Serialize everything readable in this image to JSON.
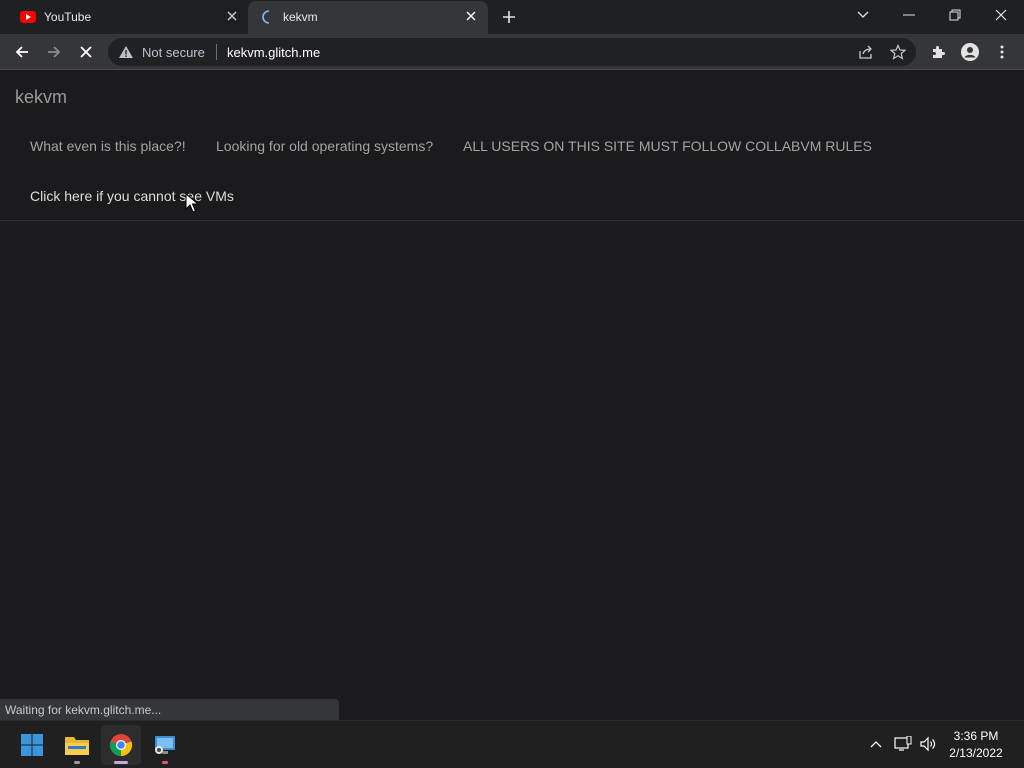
{
  "browser": {
    "tabs": [
      {
        "title": "YouTube",
        "favicon": "youtube-icon",
        "active": false
      },
      {
        "title": "kekvm",
        "favicon": "loading-spinner-icon",
        "active": true
      }
    ],
    "omnibox": {
      "security_label": "Not secure",
      "url": "kekvm.glitch.me"
    },
    "status_text": "Waiting for kekvm.glitch.me..."
  },
  "page": {
    "brand": "kekvm",
    "nav": [
      "What even is this place?!",
      "Looking for old operating systems?",
      "ALL USERS ON THIS SITE MUST FOLLOW COLLABVM RULES"
    ],
    "cta": "Click here if you cannot see VMs"
  },
  "taskbar": {
    "apps": [
      "start-icon",
      "file-explorer-icon",
      "chrome-icon",
      "remote-desktop-icon"
    ],
    "clock_time": "3:36 PM",
    "clock_date": "2/13/2022"
  },
  "colors": {
    "background": "#1b1b1d",
    "tab_active": "#35363a",
    "youtube_red": "#ff0000",
    "windows_blue": "#3a96dd"
  }
}
